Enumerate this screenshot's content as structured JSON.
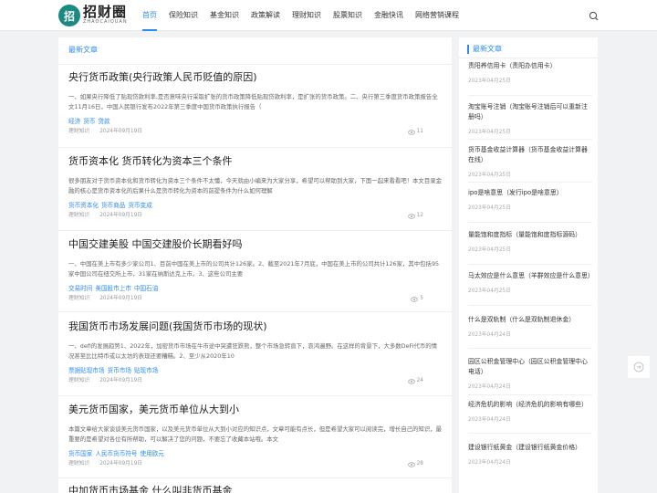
{
  "logo": {
    "glyph": "招",
    "main": "招财圈",
    "sub": "ZHAOCAIQUAN"
  },
  "nav": [
    {
      "label": "首页",
      "active": true
    },
    {
      "label": "保险知识"
    },
    {
      "label": "基金知识"
    },
    {
      "label": "政策解读"
    },
    {
      "label": "理财知识"
    },
    {
      "label": "股票知识"
    },
    {
      "label": "金融快讯"
    },
    {
      "label": "网络营销课程"
    }
  ],
  "main": {
    "section_title": "最新文章",
    "articles": [
      {
        "title": "央行货币政策(央行政策人民币贬值的原因)",
        "summary": "一、如果央行降低了贴现贷款利率,是否意味央行采取扩张的货币政策降低贴现贷款利率，是扩张的货币政策。二、央行第三季度货币政策报告全文11月16日，中国人民银行发布2022年第三季度中国货币政策执行报告（",
        "tags": [
          "经济",
          "货币",
          "贷款"
        ],
        "category": "理财知识",
        "date": "2024年09月19日",
        "views": "11"
      },
      {
        "title": "货币资本化 货币转化为资本三个条件",
        "summary": "很多朋友对于货币资本化和货币转化为资本三个条件不太懂，今天就由小编来为大家分享，希望可以帮助到大家，下面一起来看看吧！本文目录金融的核心是货币资本化的后果什么是货币转化为资本的前提条件为什么如何理解",
        "tags": [
          "货币资本化",
          "货币商品",
          "货币变成"
        ],
        "category": "理财知识",
        "date": "2024年09月19日",
        "views": "12"
      },
      {
        "title": "中国交建美股 中国交建股价长期看好吗",
        "summary": "一、中国在美上市有多少家公司1、目前中国在美上市的公司共计126家。2、截至2021年7月底，中国在美上市的公司共计126家，其中包括95家中国公司在纽交所上市，31家在纳斯达克上市。3、这些公司主要",
        "tags": [
          "交易时间",
          "美国股市上市",
          "中国石油"
        ],
        "category": "理财知识",
        "date": "2024年09月19日",
        "views": "5"
      },
      {
        "title": "我国货币市场发展问题(我国货币市场的现状)",
        "summary": "一、defi的发展趋势1、2022年，加密货币市场在牛市途中突遭狂跌熊，整个市场急转直下，哀鸿遍野。在这样的背景下，大多数DeFi代币的情况甚至比比特币或以太坊的表现还要糟糕。2、至少从2020年10",
        "tags": [
          "票据贴现市场",
          "货币市场",
          "贴现市场"
        ],
        "category": "理财知识",
        "date": "2024年09月19日",
        "views": "24"
      },
      {
        "title": "美元货币国家，美元货币单位从大到小",
        "summary": "本篇文章给大家谈谈美元货币国家，以及美元货币单位从大到小对应的知识点，文章可能有点长，但是希望大家可以阅读完，增长自己的知识，最重要的是希望对各位有所帮助，可以解决了您的问题，不要忘了收藏本站哦。本文",
        "tags": [
          "货币国家",
          "人民币货币符号",
          "使用欧元"
        ],
        "category": "理财知识",
        "date": "2024年09月19日",
        "views": "28"
      },
      {
        "title": "中加货币市场基金 什么叫非货币基金"
      }
    ]
  },
  "sidebar": {
    "title": "最新文章",
    "items": [
      {
        "title": "责阳养信用卡（责阳办信用卡）",
        "date": "2023年04月25日"
      },
      {
        "title": "淘宝账号注销（淘宝账号注销后可以重新注册吗）",
        "date": "2023年04月25日"
      },
      {
        "title": "货币基金收益计算器（货币基金收益计算器在线）",
        "date": "2023年04月25日"
      },
      {
        "title": "ipo是啥意思（发行ipo是啥意思）",
        "date": "2023年04月25日"
      },
      {
        "title": "量能饱和度指标（量能饱和度指标源码）",
        "date": "2023年04月25日"
      },
      {
        "title": "马太效应是什么意思（羊群效应是什么意思）",
        "date": "2023年04月25日"
      },
      {
        "title": "什么是双轨制（什么是双轨制退休金）",
        "date": "2023年04月24日"
      },
      {
        "title": "园区公积金管理中心（园区公积金管理中心电话）",
        "date": "2023年04月24日"
      },
      {
        "title": "经济危机的影响（经济危机的影响有哪些）",
        "date": "2023年04月24日"
      },
      {
        "title": "建设银行纸黄金（建设银行纸黄金价格）",
        "date": "2023年04月24日"
      }
    ]
  }
}
